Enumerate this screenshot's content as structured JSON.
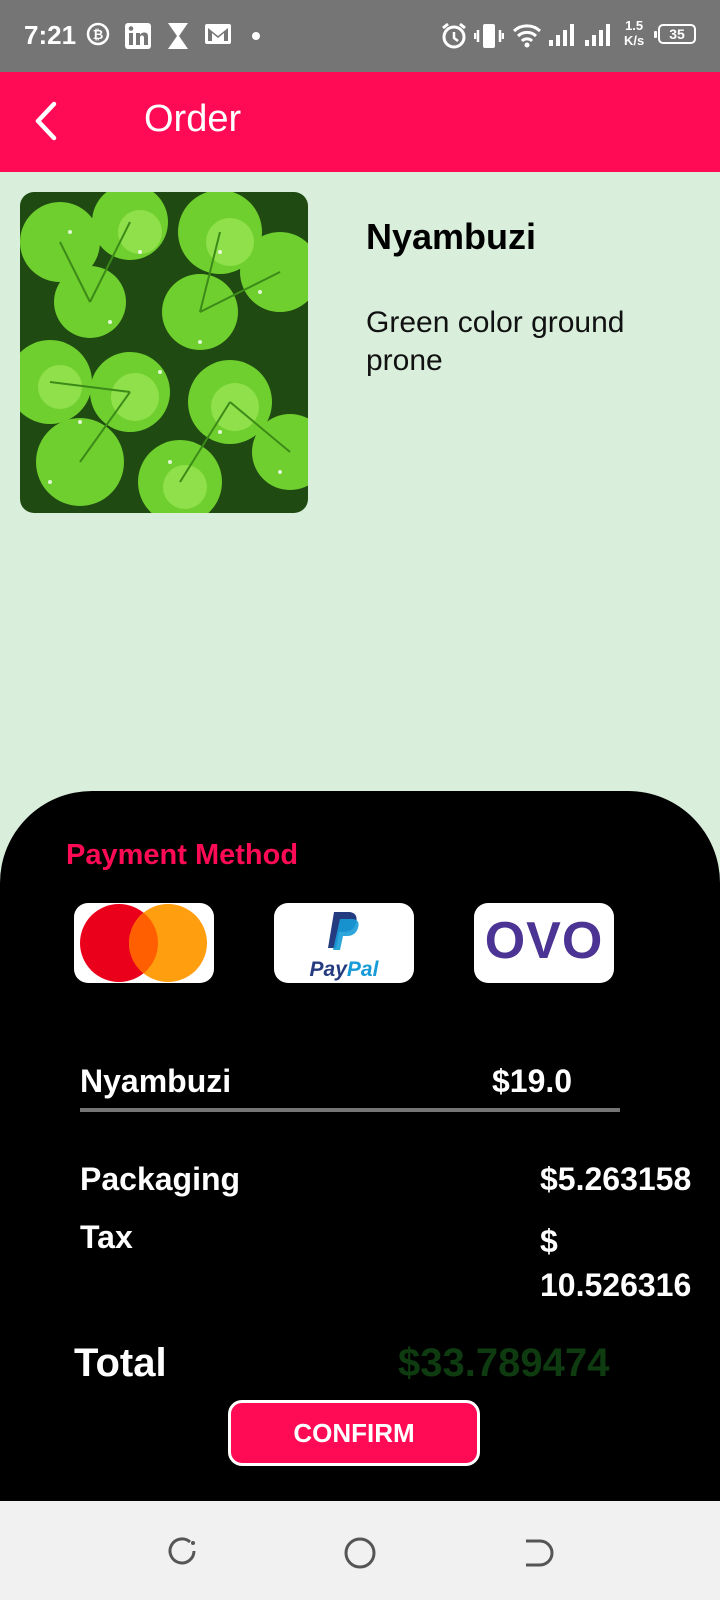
{
  "status_bar": {
    "time": "7:21",
    "net_speed_value": "1.5",
    "net_speed_unit": "K/s",
    "battery": "35",
    "notification_icons": [
      "bitcoin-icon",
      "linkedin-icon",
      "hourglass-icon",
      "gmail-icon",
      "dot-icon"
    ],
    "system_icons": [
      "alarm-icon",
      "vibrate-icon",
      "wifi-icon",
      "signal-icon",
      "signal-icon"
    ]
  },
  "app_bar": {
    "title": "Order",
    "back_icon": "back-arrow-icon",
    "color": "#ff0a54"
  },
  "product": {
    "name": "Nyambuzi",
    "description": "Green color ground prone",
    "image": "clover-leaves-photo"
  },
  "payment": {
    "title": "Payment Method",
    "methods": [
      {
        "name": "mastercard",
        "icon": "mastercard-logo"
      },
      {
        "name": "paypal",
        "label_pay": "Pay",
        "label_pal": "Pal"
      },
      {
        "name": "ovo",
        "label": "OVO"
      }
    ]
  },
  "summary": {
    "item_name": "Nyambuzi",
    "item_price": "$19.0",
    "packaging_label": "Packaging",
    "packaging_value": "$5.263158",
    "tax_label": "Tax",
    "tax_value": "$\n10.526316",
    "total_label": "Total",
    "total_value": "$33.789474",
    "total_color": "#0e3b10"
  },
  "confirm_label": "CONFIRM",
  "nav_bar": {
    "icons": [
      "recents-icon",
      "home-icon",
      "back-icon"
    ]
  }
}
